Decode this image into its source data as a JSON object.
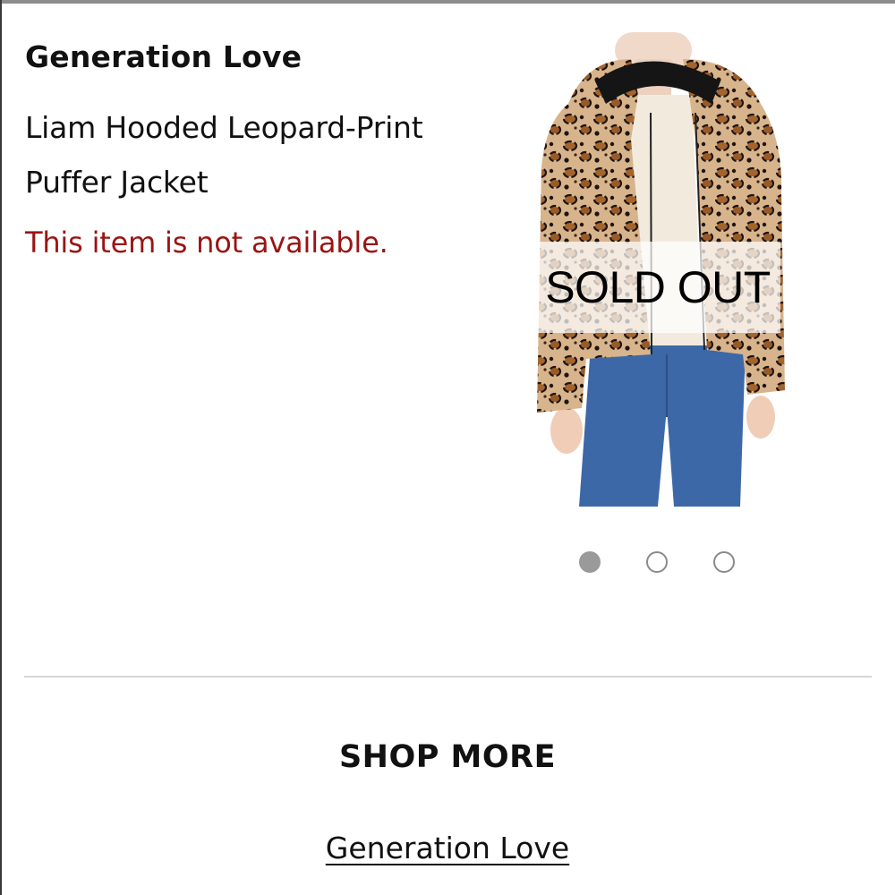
{
  "product": {
    "brand": "Generation Love",
    "name_line1": "Liam Hooded Leopard-Print",
    "name_line2": "Puffer Jacket",
    "availability_message": "This item is not available.",
    "availability_color": "#9a1414"
  },
  "image": {
    "overlay_label": "SOLD OUT",
    "carousel": {
      "total": 3,
      "active_index": 0
    }
  },
  "shop_more": {
    "heading": "SHOP MORE",
    "brand_link": "Generation Love"
  }
}
